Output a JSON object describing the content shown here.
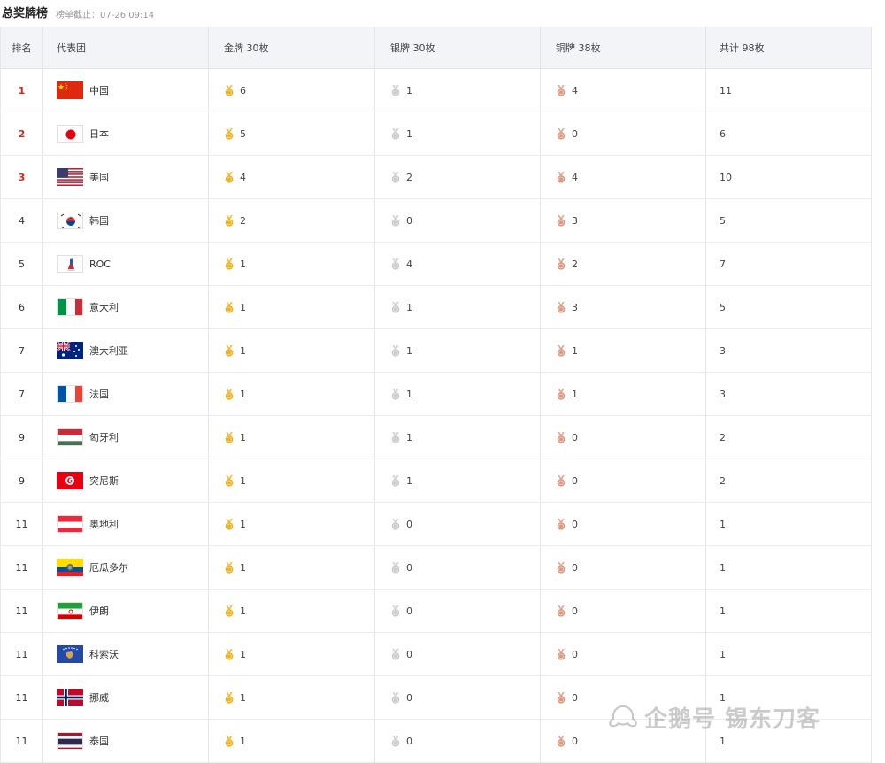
{
  "header": {
    "title": "总奖牌榜",
    "deadline": "榜单截止：07-26 09:14"
  },
  "columns": {
    "rank": "排名",
    "team": "代表团",
    "gold": "金牌 30枚",
    "silver": "银牌 30枚",
    "bronze": "铜牌 38枚",
    "total": "共计 98枚"
  },
  "medal_colors": {
    "gold": "#f2b11c",
    "silver": "#c9c9c9",
    "bronze": "#d99a82"
  },
  "rows": [
    {
      "rank": "1",
      "name": "中国",
      "flag": "china",
      "gold": "6",
      "silver": "1",
      "bronze": "4",
      "total": "11"
    },
    {
      "rank": "2",
      "name": "日本",
      "flag": "japan",
      "gold": "5",
      "silver": "1",
      "bronze": "0",
      "total": "6"
    },
    {
      "rank": "3",
      "name": "美国",
      "flag": "usa",
      "gold": "4",
      "silver": "2",
      "bronze": "4",
      "total": "10"
    },
    {
      "rank": "4",
      "name": "韩国",
      "flag": "korea",
      "gold": "2",
      "silver": "0",
      "bronze": "3",
      "total": "5"
    },
    {
      "rank": "5",
      "name": "ROC",
      "flag": "roc",
      "gold": "1",
      "silver": "4",
      "bronze": "2",
      "total": "7"
    },
    {
      "rank": "6",
      "name": "意大利",
      "flag": "italy",
      "gold": "1",
      "silver": "1",
      "bronze": "3",
      "total": "5"
    },
    {
      "rank": "7",
      "name": "澳大利亚",
      "flag": "australia",
      "gold": "1",
      "silver": "1",
      "bronze": "1",
      "total": "3"
    },
    {
      "rank": "7",
      "name": "法国",
      "flag": "france",
      "gold": "1",
      "silver": "1",
      "bronze": "1",
      "total": "3"
    },
    {
      "rank": "9",
      "name": "匈牙利",
      "flag": "hungary",
      "gold": "1",
      "silver": "1",
      "bronze": "0",
      "total": "2"
    },
    {
      "rank": "9",
      "name": "突尼斯",
      "flag": "tunisia",
      "gold": "1",
      "silver": "1",
      "bronze": "0",
      "total": "2"
    },
    {
      "rank": "11",
      "name": "奥地利",
      "flag": "austria",
      "gold": "1",
      "silver": "0",
      "bronze": "0",
      "total": "1"
    },
    {
      "rank": "11",
      "name": "厄瓜多尔",
      "flag": "ecuador",
      "gold": "1",
      "silver": "0",
      "bronze": "0",
      "total": "1"
    },
    {
      "rank": "11",
      "name": "伊朗",
      "flag": "iran",
      "gold": "1",
      "silver": "0",
      "bronze": "0",
      "total": "1"
    },
    {
      "rank": "11",
      "name": "科索沃",
      "flag": "kosovo",
      "gold": "1",
      "silver": "0",
      "bronze": "0",
      "total": "1"
    },
    {
      "rank": "11",
      "name": "挪威",
      "flag": "norway",
      "gold": "1",
      "silver": "0",
      "bronze": "0",
      "total": "1"
    },
    {
      "rank": "11",
      "name": "泰国",
      "flag": "thailand",
      "gold": "1",
      "silver": "0",
      "bronze": "0",
      "total": "1"
    }
  ],
  "watermark": "企鹅号 锡东刀客"
}
